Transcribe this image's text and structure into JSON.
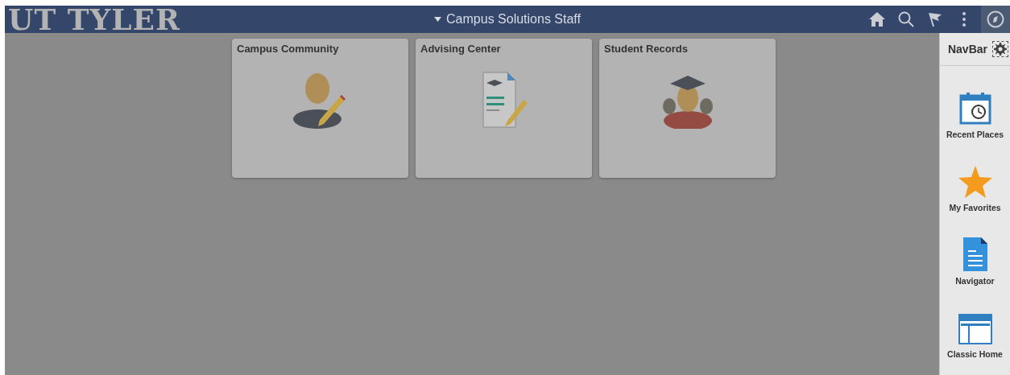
{
  "header": {
    "logo": "UT TYLER",
    "title": "Campus Solutions Staff",
    "actions": [
      {
        "kind": "home",
        "selected": false
      },
      {
        "kind": "search",
        "selected": false
      },
      {
        "kind": "flag",
        "selected": false
      },
      {
        "kind": "menu",
        "selected": false
      },
      {
        "kind": "compass",
        "selected": true
      }
    ]
  },
  "tiles": [
    {
      "title": "Campus Community",
      "kind": "person"
    },
    {
      "title": "Advising Center",
      "kind": "document"
    },
    {
      "title": "Student Records",
      "kind": "graduates"
    }
  ],
  "navbar": {
    "title": "NavBar",
    "items": [
      {
        "label": "Recent Places",
        "kind": "calendar"
      },
      {
        "label": "My Favorites",
        "kind": "star"
      },
      {
        "label": "Navigator",
        "kind": "page"
      },
      {
        "label": "Classic Home",
        "kind": "window"
      }
    ]
  }
}
